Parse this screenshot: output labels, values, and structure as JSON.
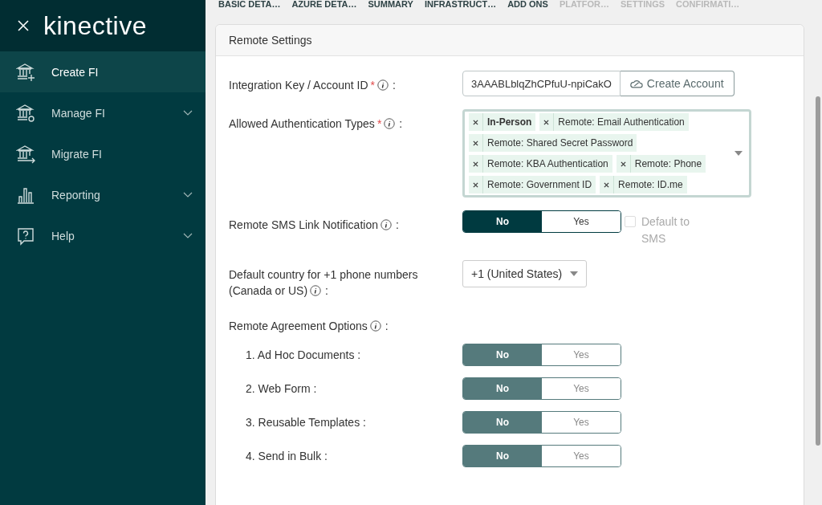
{
  "sidebar": {
    "logo": "kinective",
    "items": [
      {
        "label": "Create FI",
        "selected": true,
        "expandable": false
      },
      {
        "label": "Manage FI",
        "selected": false,
        "expandable": true
      },
      {
        "label": "Migrate FI",
        "selected": false,
        "expandable": false
      },
      {
        "label": "Reporting",
        "selected": false,
        "expandable": true
      },
      {
        "label": "Help",
        "selected": false,
        "expandable": true
      }
    ]
  },
  "steps": [
    {
      "label": "BASIC DETA…",
      "disabled": false
    },
    {
      "label": "AZURE DETA…",
      "disabled": false
    },
    {
      "label": "SUMMARY",
      "disabled": false
    },
    {
      "label": "INFRASTRUCT…",
      "disabled": false
    },
    {
      "label": "ADD ONS",
      "disabled": false
    },
    {
      "label": "PLATFOR…",
      "disabled": true
    },
    {
      "label": "SETTINGS",
      "disabled": true
    },
    {
      "label": "CONFIRMATI…",
      "disabled": true
    }
  ],
  "card": {
    "title": "Remote Settings",
    "integration_key": {
      "label": "Integration Key / Account ID",
      "required_mark": "*",
      "suffix": ":",
      "value": "3AAABLblqZhCPfuU-npiCakO",
      "button": "Create Account"
    },
    "auth_types": {
      "label": "Allowed Authentication Types",
      "required_mark": "*",
      "suffix": ":",
      "tags": [
        {
          "label": "In-Person",
          "bold": true
        },
        {
          "label": "Remote: Email Authentication",
          "bold": false
        },
        {
          "label": "Remote: Shared Secret Password",
          "bold": false
        },
        {
          "label": "Remote: KBA Authentication",
          "bold": false
        },
        {
          "label": "Remote: Phone",
          "bold": false
        },
        {
          "label": "Remote: Government ID",
          "bold": false
        },
        {
          "label": "Remote: ID.me",
          "bold": false
        }
      ]
    },
    "sms": {
      "label": "Remote SMS Link Notification",
      "suffix": ":",
      "disabled": false,
      "options": [
        {
          "label": "No",
          "selected": true
        },
        {
          "label": "Yes",
          "selected": false
        }
      ],
      "checkbox": {
        "label": "Default to SMS",
        "checked": false,
        "disabled": true
      }
    },
    "country": {
      "label": "Default country for +1 phone numbers (Canada or US)",
      "suffix": ":",
      "value": "+1 (United States)"
    },
    "agreement": {
      "label": "Remote Agreement Options",
      "suffix": ":",
      "items": [
        {
          "label": "1. Ad Hoc Documents :",
          "disabled": true,
          "options": [
            {
              "label": "No",
              "selected": true
            },
            {
              "label": "Yes",
              "selected": false
            }
          ]
        },
        {
          "label": "2. Web Form :",
          "disabled": true,
          "options": [
            {
              "label": "No",
              "selected": true
            },
            {
              "label": "Yes",
              "selected": false
            }
          ]
        },
        {
          "label": "3. Reusable Templates :",
          "disabled": true,
          "options": [
            {
              "label": "No",
              "selected": true
            },
            {
              "label": "Yes",
              "selected": false
            }
          ]
        },
        {
          "label": "4. Send in Bulk :",
          "disabled": true,
          "options": [
            {
              "label": "No",
              "selected": true
            },
            {
              "label": "Yes",
              "selected": false
            }
          ]
        }
      ]
    }
  }
}
